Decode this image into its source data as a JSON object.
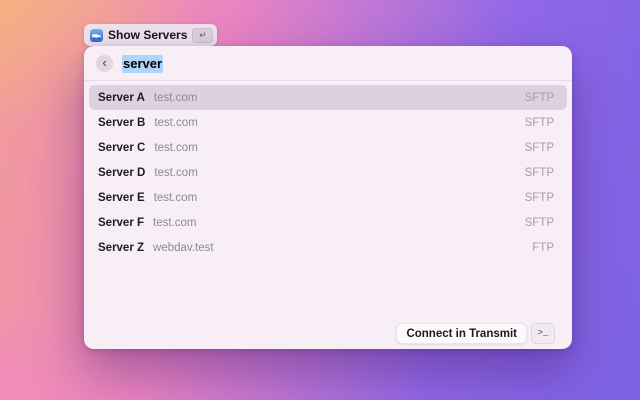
{
  "toolbar": {
    "show_servers": {
      "label": "Show Servers",
      "shortcut_glyph": "↵"
    }
  },
  "search": {
    "back_glyph": "‹",
    "query": "server"
  },
  "server_list": {
    "rows": [
      {
        "name": "Server A",
        "host": "test.com",
        "protocol": "SFTP",
        "selected": true
      },
      {
        "name": "Server B",
        "host": "test.com",
        "protocol": "SFTP",
        "selected": false
      },
      {
        "name": "Server C",
        "host": "test.com",
        "protocol": "SFTP",
        "selected": false
      },
      {
        "name": "Server D",
        "host": "test.com",
        "protocol": "SFTP",
        "selected": false
      },
      {
        "name": "Server E",
        "host": "test.com",
        "protocol": "SFTP",
        "selected": false
      },
      {
        "name": "Server F",
        "host": "test.com",
        "protocol": "SFTP",
        "selected": false
      },
      {
        "name": "Server Z",
        "host": "webdav.test",
        "protocol": "FTP",
        "selected": false
      }
    ]
  },
  "footer": {
    "connect_label": "Connect in Transmit",
    "shortcut_glyph": ">_"
  },
  "colors": {
    "panel_bg": "#f7eef6",
    "row_selected": "#ddd0e1",
    "selection_highlight": "#aed4f9",
    "background_gradient": [
      "#f6b57e",
      "#f29d98",
      "#ea84c2",
      "#9168e8",
      "#7c62e4"
    ]
  }
}
